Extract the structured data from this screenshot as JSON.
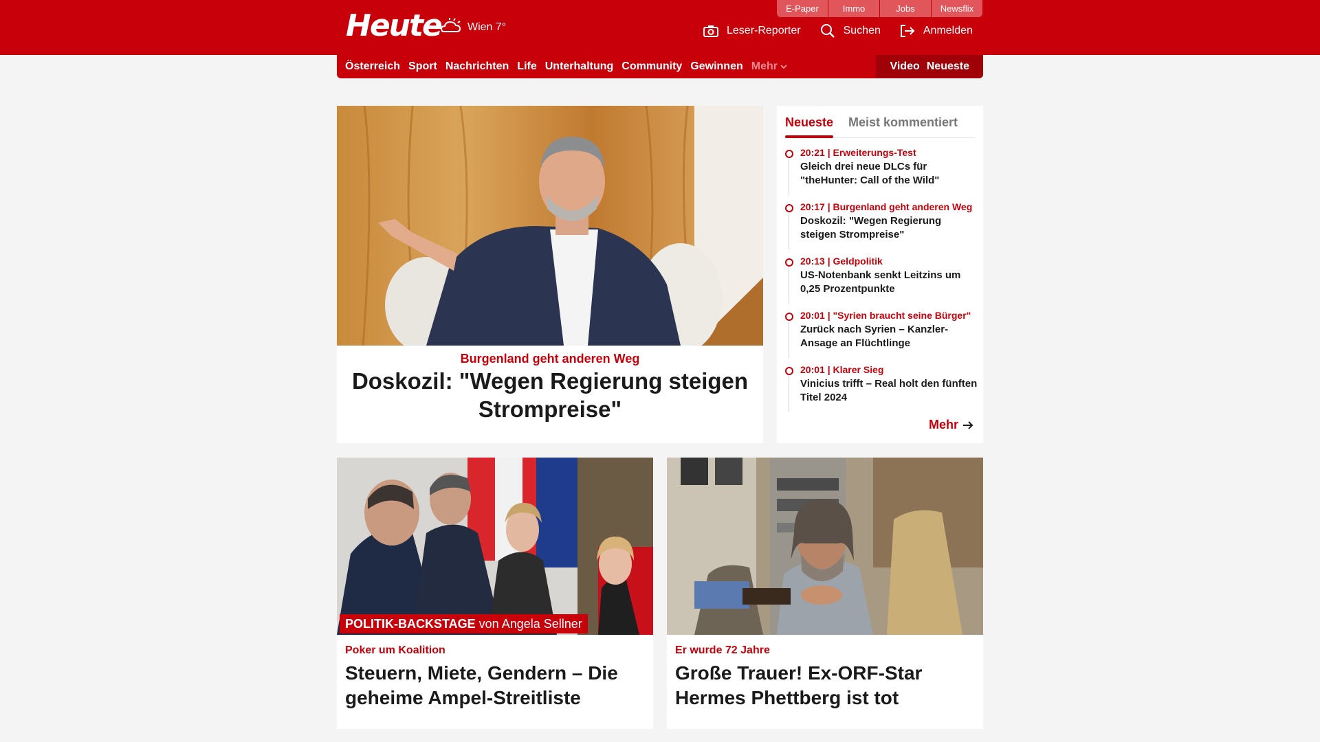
{
  "header": {
    "logo": "Heute",
    "weather": "Wien 7°",
    "top_links": [
      "E-Paper",
      "Immo",
      "Jobs",
      "Newsflix"
    ],
    "actions": {
      "leser_reporter": "Leser-Reporter",
      "suchen": "Suchen",
      "anmelden": "Anmelden"
    }
  },
  "nav": {
    "items": [
      "Österreich",
      "Sport",
      "Nachrichten",
      "Life",
      "Unterhaltung",
      "Community",
      "Gewinnen"
    ],
    "more": "Mehr",
    "right": [
      "Video",
      "Neueste"
    ]
  },
  "hero": {
    "kicker": "Burgenland geht anderen Weg",
    "title": "Doskozil: \"Wegen Regierung steigen Strompreise\""
  },
  "sidebar": {
    "tabs": [
      "Neueste",
      "Meist kommentiert"
    ],
    "items": [
      {
        "meta": "20:21 | Erweiterungs-Test",
        "title": "Gleich drei neue DLCs für \"theHunter: Call of the Wild\""
      },
      {
        "meta": "20:17 | Burgenland geht anderen Weg",
        "title": "Doskozil: \"Wegen Regierung steigen Strompreise\""
      },
      {
        "meta": "20:13 | Geldpolitik",
        "title": "US-Notenbank senkt Leitzins um 0,25 Prozentpunkte"
      },
      {
        "meta": "20:01 | \"Syrien braucht seine Bürger\"",
        "title": "Zurück nach Syrien – Kanzler-Ansage an Flüchtlinge"
      },
      {
        "meta": "20:01 | Klarer Sieg",
        "title": "Vinicius trifft – Real holt den fünften Titel 2024"
      }
    ],
    "more": "Mehr"
  },
  "cards": [
    {
      "badge_bold": "POLITIK-BACKSTAGE",
      "badge_rest": " von Angela Sellner",
      "kicker": "Poker um Koalition",
      "title": "Steuern, Miete, Gendern – Die geheime Ampel-Streitliste"
    },
    {
      "kicker": "Er wurde 72 Jahre",
      "title": "Große Trauer! Ex-ORF-Star Hermes Phettberg ist tot"
    }
  ],
  "colors": {
    "brand_red": "#c8000a",
    "dark_red": "#a00008",
    "background": "#f4f4f4"
  }
}
